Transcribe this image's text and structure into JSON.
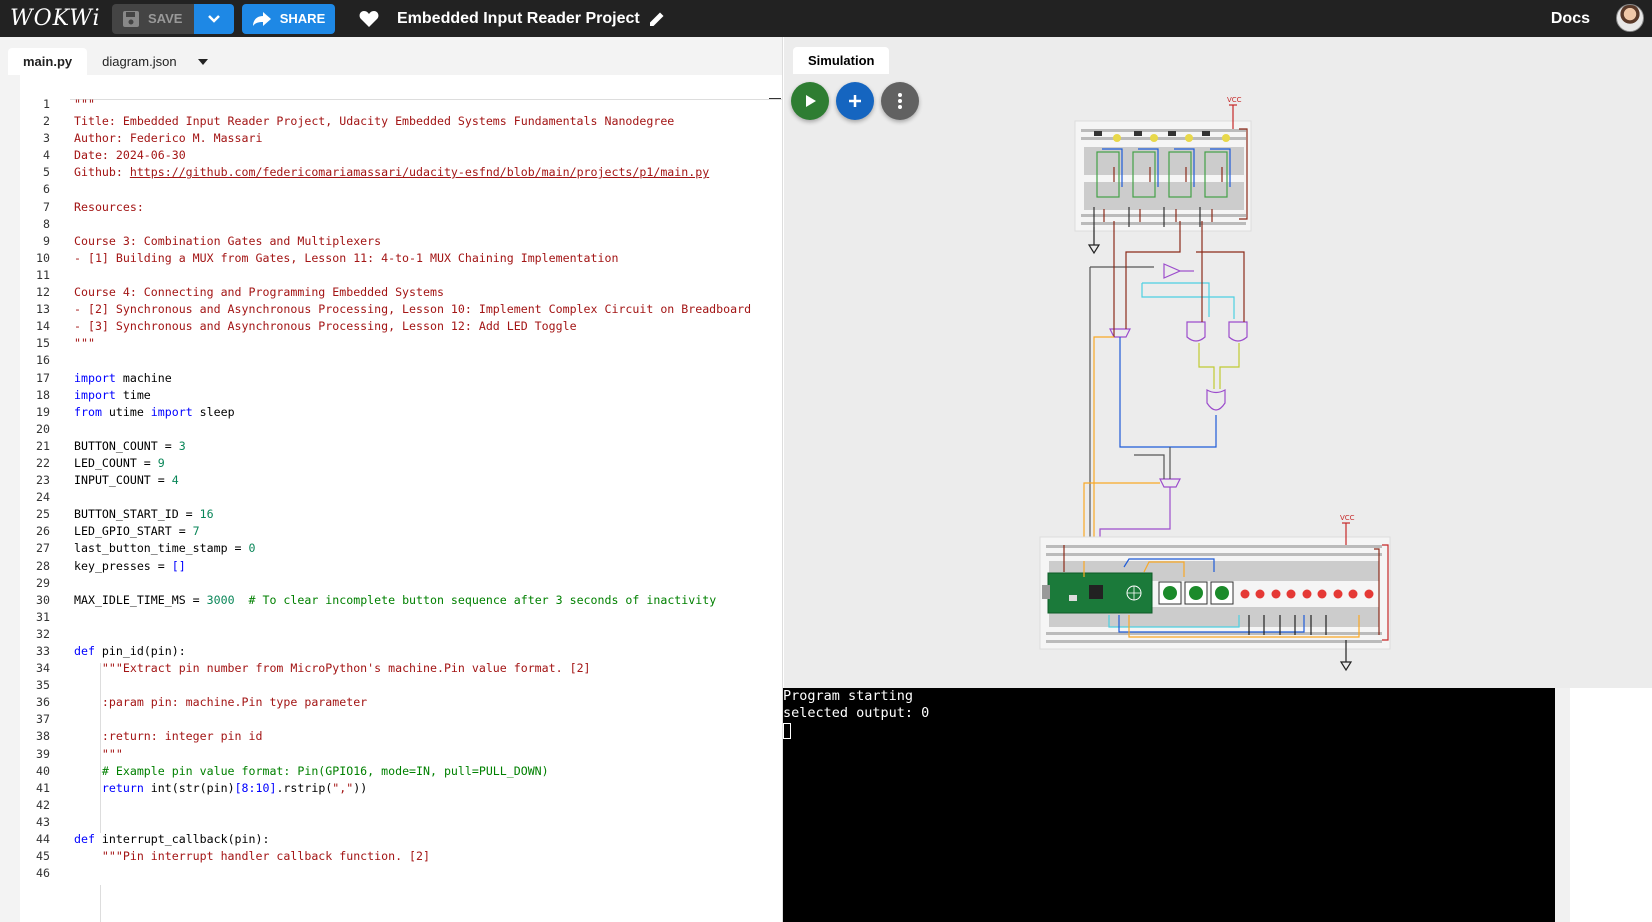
{
  "header": {
    "logo_text": "WOKWi",
    "save_label": "SAVE",
    "share_label": "SHARE",
    "project_title": "Embedded Input Reader Project",
    "docs_label": "Docs",
    "accent_color": "#1e88e5"
  },
  "editor": {
    "tabs": [
      {
        "label": "main.py",
        "active": true
      },
      {
        "label": "diagram.json",
        "active": false
      }
    ],
    "lines": [
      {
        "n": "1",
        "t": [
          [
            "s",
            "\"\"\""
          ]
        ]
      },
      {
        "n": "2",
        "t": [
          [
            "s",
            "Title: Embedded Input Reader Project, Udacity Embedded Systems Fundamentals Nanodegree"
          ]
        ]
      },
      {
        "n": "3",
        "t": [
          [
            "s",
            "Author: Federico M. Massari"
          ]
        ]
      },
      {
        "n": "4",
        "t": [
          [
            "s",
            "Date: 2024-06-30"
          ]
        ]
      },
      {
        "n": "5",
        "t": [
          [
            "s",
            "Github: "
          ],
          [
            "l",
            "https://github.com/federicomariamassari/udacity-esfnd/blob/main/projects/p1/main.py"
          ]
        ]
      },
      {
        "n": "6",
        "t": []
      },
      {
        "n": "7",
        "t": [
          [
            "s",
            "Resources:"
          ]
        ]
      },
      {
        "n": "8",
        "t": []
      },
      {
        "n": "9",
        "t": [
          [
            "s",
            "Course 3: Combination Gates and Multiplexers"
          ]
        ]
      },
      {
        "n": "10",
        "t": [
          [
            "s",
            "- [1] Building a MUX from Gates, Lesson 11: 4-to-1 MUX Chaining Implementation"
          ]
        ]
      },
      {
        "n": "11",
        "t": []
      },
      {
        "n": "12",
        "t": [
          [
            "s",
            "Course 4: Connecting and Programming Embedded Systems"
          ]
        ]
      },
      {
        "n": "13",
        "t": [
          [
            "s",
            "- [2] Synchronous and Asynchronous Processing, Lesson 10: Implement Complex Circuit on Breadboard"
          ]
        ]
      },
      {
        "n": "14",
        "t": [
          [
            "s",
            "- [3] Synchronous and Asynchronous Processing, Lesson 12: Add LED Toggle"
          ]
        ]
      },
      {
        "n": "15",
        "t": [
          [
            "s",
            "\"\"\""
          ]
        ]
      },
      {
        "n": "16",
        "t": []
      },
      {
        "n": "17",
        "t": [
          [
            "k",
            "import"
          ],
          [
            "i",
            " machine"
          ]
        ]
      },
      {
        "n": "18",
        "t": [
          [
            "k",
            "import"
          ],
          [
            "i",
            " time"
          ]
        ]
      },
      {
        "n": "19",
        "t": [
          [
            "k",
            "from"
          ],
          [
            "i",
            " utime "
          ],
          [
            "k",
            "import"
          ],
          [
            "i",
            " sleep"
          ]
        ]
      },
      {
        "n": "20",
        "t": []
      },
      {
        "n": "21",
        "t": [
          [
            "i",
            "BUTTON_COUNT = "
          ],
          [
            "n",
            "3"
          ]
        ]
      },
      {
        "n": "22",
        "t": [
          [
            "i",
            "LED_COUNT = "
          ],
          [
            "n",
            "9"
          ]
        ]
      },
      {
        "n": "23",
        "t": [
          [
            "i",
            "INPUT_COUNT = "
          ],
          [
            "n",
            "4"
          ]
        ]
      },
      {
        "n": "24",
        "t": []
      },
      {
        "n": "25",
        "t": [
          [
            "i",
            "BUTTON_START_ID = "
          ],
          [
            "n",
            "16"
          ]
        ]
      },
      {
        "n": "26",
        "t": [
          [
            "i",
            "LED_GPIO_START = "
          ],
          [
            "n",
            "7"
          ]
        ]
      },
      {
        "n": "27",
        "t": [
          [
            "i",
            "last_button_time_stamp = "
          ],
          [
            "n",
            "0"
          ]
        ]
      },
      {
        "n": "28",
        "t": [
          [
            "i",
            "key_presses = "
          ],
          [
            "k",
            "[]"
          ]
        ]
      },
      {
        "n": "29",
        "t": []
      },
      {
        "n": "30",
        "t": [
          [
            "i",
            "MAX_IDLE_TIME_MS = "
          ],
          [
            "n",
            "3000"
          ],
          [
            "i",
            "  "
          ],
          [
            "c",
            "# To clear incomplete button sequence after 3 seconds of inactivity"
          ]
        ]
      },
      {
        "n": "31",
        "t": []
      },
      {
        "n": "32",
        "t": []
      },
      {
        "n": "33",
        "t": [
          [
            "k",
            "def"
          ],
          [
            "i",
            " pin_id(pin):"
          ]
        ]
      },
      {
        "n": "34",
        "t": [
          [
            "i",
            "    "
          ],
          [
            "s",
            "\"\"\"Extract pin number from MicroPython's machine.Pin value format. [2]"
          ]
        ]
      },
      {
        "n": "35",
        "t": []
      },
      {
        "n": "36",
        "t": [
          [
            "i",
            "    "
          ],
          [
            "s",
            ":param pin: machine.Pin type parameter"
          ]
        ]
      },
      {
        "n": "37",
        "t": []
      },
      {
        "n": "38",
        "t": [
          [
            "i",
            "    "
          ],
          [
            "s",
            ":return: integer pin id"
          ]
        ]
      },
      {
        "n": "39",
        "t": [
          [
            "i",
            "    "
          ],
          [
            "s",
            "\"\"\""
          ]
        ]
      },
      {
        "n": "40",
        "t": [
          [
            "i",
            "    "
          ],
          [
            "c",
            "# Example pin value format: Pin(GPIO16, mode=IN, pull=PULL_DOWN)"
          ]
        ]
      },
      {
        "n": "41",
        "t": [
          [
            "i",
            "    "
          ],
          [
            "k",
            "return"
          ],
          [
            "i",
            " int(str(pin)"
          ],
          [
            "k",
            "[8:10]"
          ],
          [
            "i",
            ".rstrip("
          ],
          [
            "s",
            "\",\""
          ],
          [
            "i",
            "))"
          ]
        ]
      },
      {
        "n": "42",
        "t": []
      },
      {
        "n": "43",
        "t": []
      },
      {
        "n": "44",
        "t": [
          [
            "k",
            "def"
          ],
          [
            "i",
            " interrupt_callback(pin):"
          ]
        ]
      },
      {
        "n": "45",
        "t": [
          [
            "i",
            "    "
          ],
          [
            "s",
            "\"\"\"Pin interrupt handler callback function. [2]"
          ]
        ]
      },
      {
        "n": "46",
        "t": []
      }
    ]
  },
  "simulation": {
    "tab_label": "Simulation",
    "buttons": [
      {
        "name": "play-icon"
      },
      {
        "name": "plus-icon"
      },
      {
        "name": "more-vertical-icon"
      }
    ],
    "vcc_label": "VCC"
  },
  "console": {
    "lines": [
      "Program starting",
      "selected output: 0"
    ]
  }
}
